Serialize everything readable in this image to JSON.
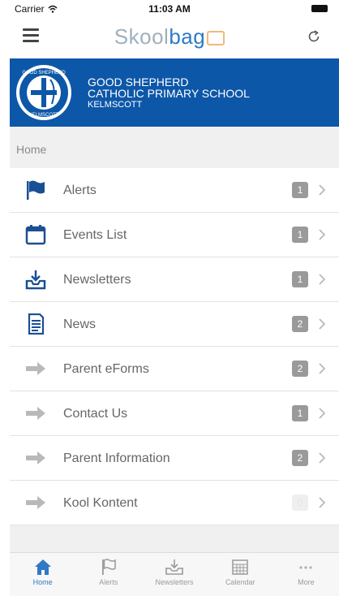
{
  "status_bar": {
    "carrier": "Carrier",
    "time": "11:03 AM"
  },
  "header": {
    "logo_part1": "Skool",
    "logo_part2": "bag",
    "menu_icon": "hamburger-icon",
    "refresh_icon": "refresh-icon"
  },
  "banner": {
    "line1": "GOOD SHEPHERD",
    "line2": "CATHOLIC PRIMARY SCHOOL",
    "line3": "KELMSCOTT",
    "crest_top_text": "GOOD SHEPHERD",
    "crest_bottom_text": "KELMSCOTT"
  },
  "section": {
    "title": "Home"
  },
  "items": [
    {
      "label": "Alerts",
      "badge": "1",
      "icon": "flag-icon"
    },
    {
      "label": "Events List",
      "badge": "1",
      "icon": "calendar-icon"
    },
    {
      "label": "Newsletters",
      "badge": "1",
      "icon": "inbox-icon"
    },
    {
      "label": "News",
      "badge": "2",
      "icon": "document-icon"
    },
    {
      "label": "Parent eForms",
      "badge": "2",
      "icon": "arrow-right-icon"
    },
    {
      "label": "Contact Us",
      "badge": "1",
      "icon": "arrow-right-icon"
    },
    {
      "label": "Parent Information",
      "badge": "2",
      "icon": "arrow-right-icon"
    },
    {
      "label": "Kool Kontent",
      "badge": "0",
      "icon": "arrow-right-icon"
    }
  ],
  "tabs": [
    {
      "label": "Home",
      "icon": "home-icon",
      "active": true
    },
    {
      "label": "Alerts",
      "icon": "flag-icon",
      "active": false
    },
    {
      "label": "Newsletters",
      "icon": "inbox-icon",
      "active": false
    },
    {
      "label": "Calendar",
      "icon": "calendar-icon",
      "active": false
    },
    {
      "label": "More",
      "icon": "more-icon",
      "active": false
    }
  ],
  "colors": {
    "brand_blue": "#0d57a8",
    "accent_blue": "#2f79c6",
    "badge_grey": "#9a9a9a"
  }
}
